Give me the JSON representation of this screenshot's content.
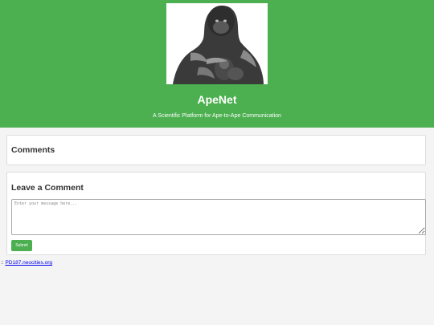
{
  "header": {
    "logo_icon": "gorilla-image",
    "title": "ApeNet",
    "tagline": "A Scientific Platform for Ape-to-Ape Communication",
    "background_color": "#4caf50"
  },
  "comments_section": {
    "heading": "Comments"
  },
  "leave_comment_section": {
    "heading": "Leave a Comment",
    "message_placeholder": "Enter your message here...",
    "message_value": "",
    "submit_label": "Submit"
  },
  "footer": {
    "prefix": "::",
    "link_text": "PD187.neocities.org"
  }
}
